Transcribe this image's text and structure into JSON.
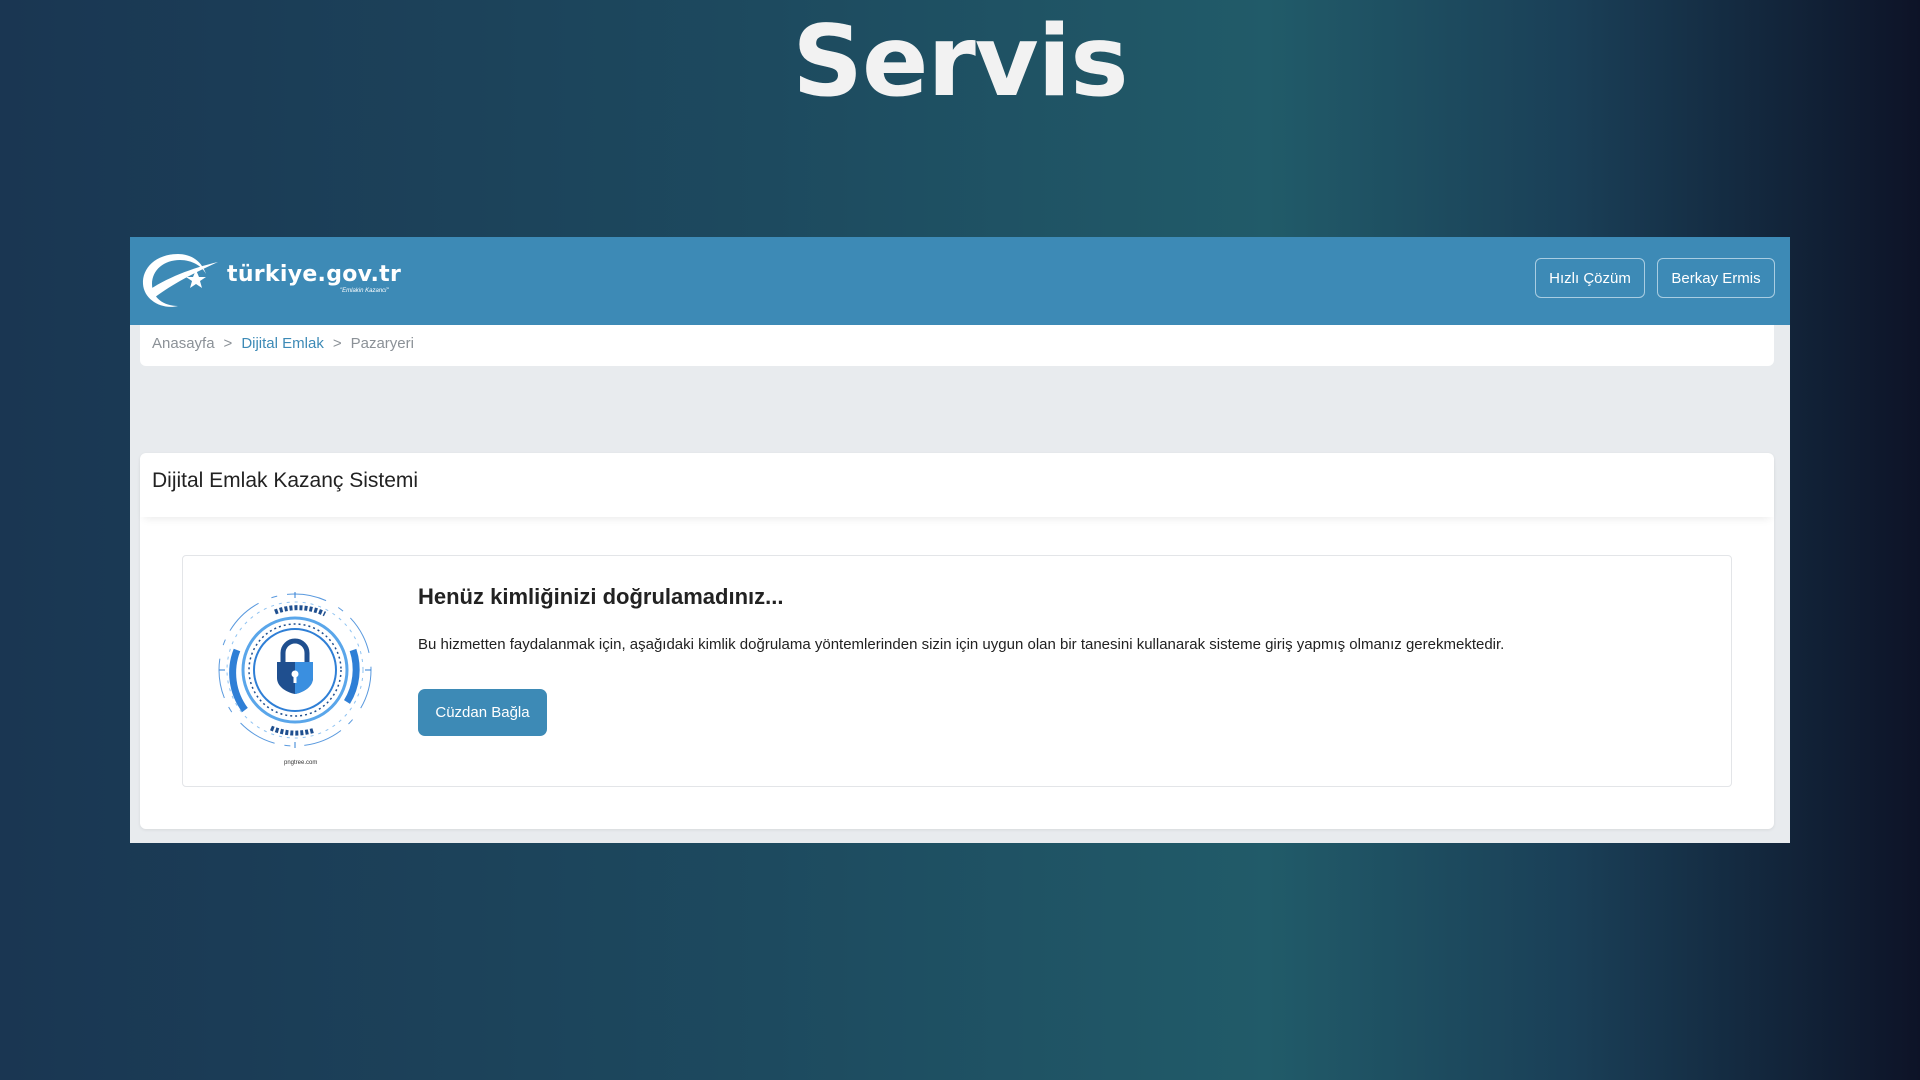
{
  "slide": {
    "title": "Servis"
  },
  "header": {
    "logo_text": "türkiye.gov.tr",
    "logo_tagline": "\"Emlakin Kazanci\"",
    "buttons": {
      "quick_solution": "Hızlı Çözüm",
      "user": "Berkay Ermis"
    }
  },
  "breadcrumb": {
    "items": [
      "Anasayfa",
      "Dijital Emlak",
      "Pazaryeri"
    ],
    "separator": ">"
  },
  "card": {
    "title": "Dijital Emlak Kazanç Sistemi",
    "message_title": "Henüz kimliğinizi doğrulamadınız...",
    "message_text": "Bu hizmetten faydalanmak için, aşağıdaki kimlik doğrulama yöntemlerinden sizin için uygun olan bir tanesini kullanarak sisteme giriş yapmış olmanız gerekmektedir.",
    "button_label": "Cüzdan Bağla",
    "illustration_caption": "pngtree.com"
  },
  "colors": {
    "brand_blue": "#3d8ab6",
    "page_bg": "#e8ebee"
  },
  "icons": {
    "logo": "crescent-star-logo-icon",
    "illustration": "lock-shield-icon"
  }
}
